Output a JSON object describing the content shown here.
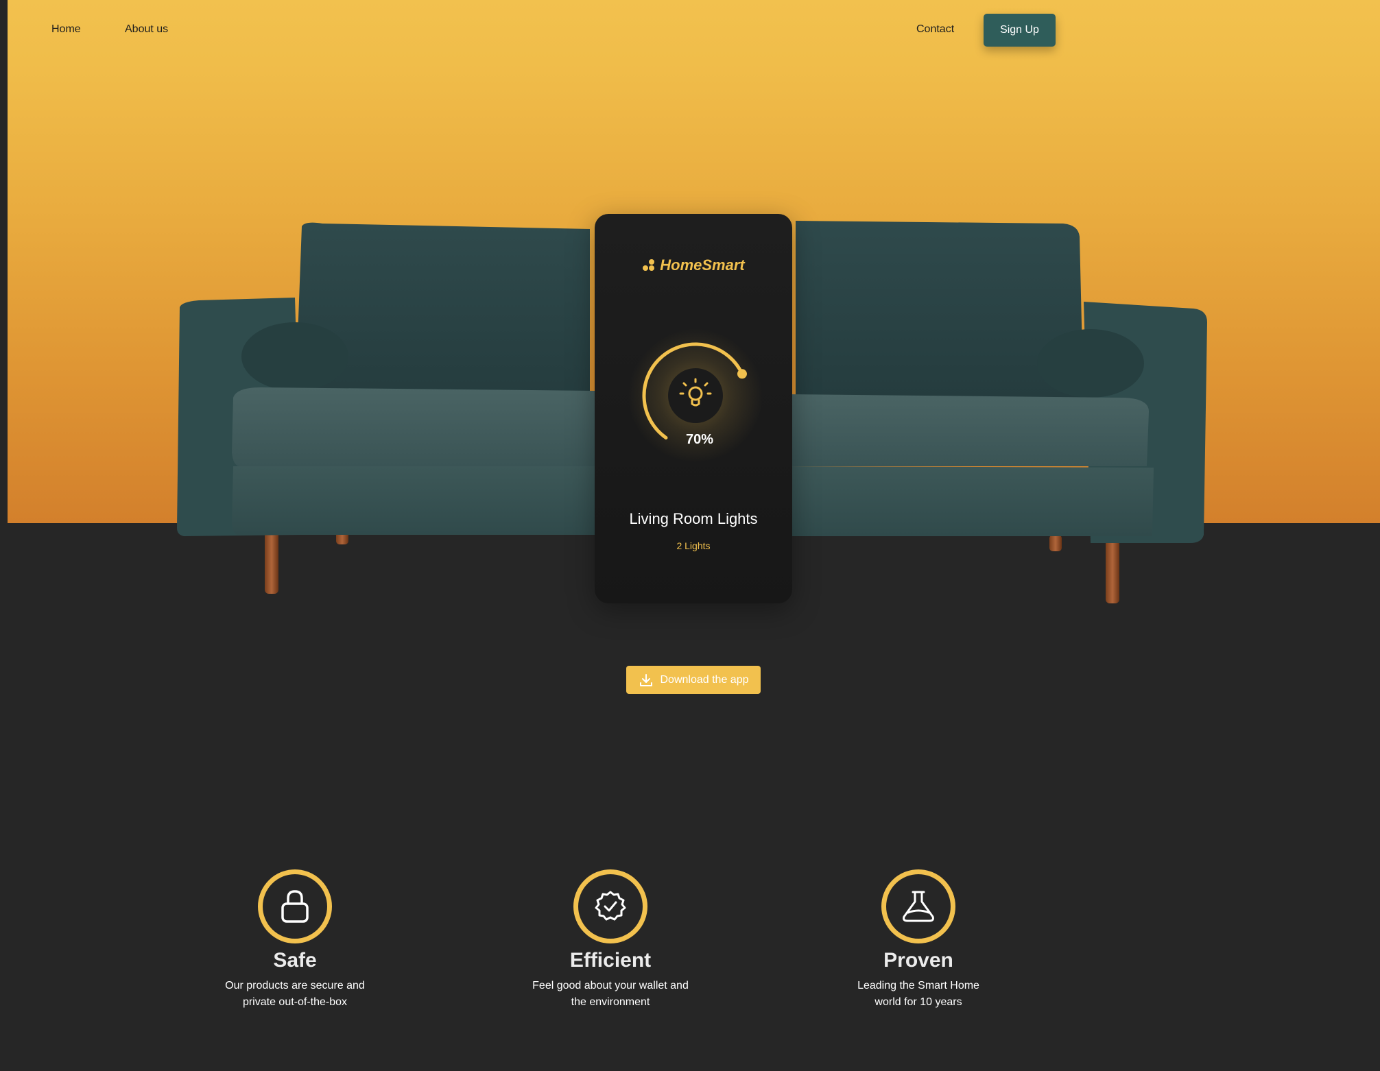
{
  "nav": {
    "home": "Home",
    "about": "About us",
    "contact": "Contact",
    "signup": "Sign Up"
  },
  "hero": {
    "image": "green-velvet-sofa",
    "gradient": [
      "#f2c14e",
      "#d3802c"
    ]
  },
  "phone": {
    "brand": "HomeSmart",
    "brand_icon": "dots-logo-icon",
    "dial_icon": "lightbulb-icon",
    "level_percent": 70,
    "level_label": "70%",
    "room_title": "Living Room Lights",
    "room_subtitle": "2 Lights"
  },
  "cta": {
    "label": "Download the app",
    "icon": "download-icon"
  },
  "features": [
    {
      "icon": "lock-icon",
      "title": "Safe",
      "line1": "Our products are secure and",
      "line2": "private out-of-the-box"
    },
    {
      "icon": "badge-check-icon",
      "title": "Efficient",
      "line1": "Feel good about your wallet and",
      "line2": "the environment"
    },
    {
      "icon": "flask-icon",
      "title": "Proven",
      "line1": "Leading the Smart Home",
      "line2": "world for 10 years"
    }
  ],
  "colors": {
    "accent": "#f2c14e",
    "button": "#2f5d5a",
    "background": "#262626",
    "card": "#1a1a1a"
  }
}
